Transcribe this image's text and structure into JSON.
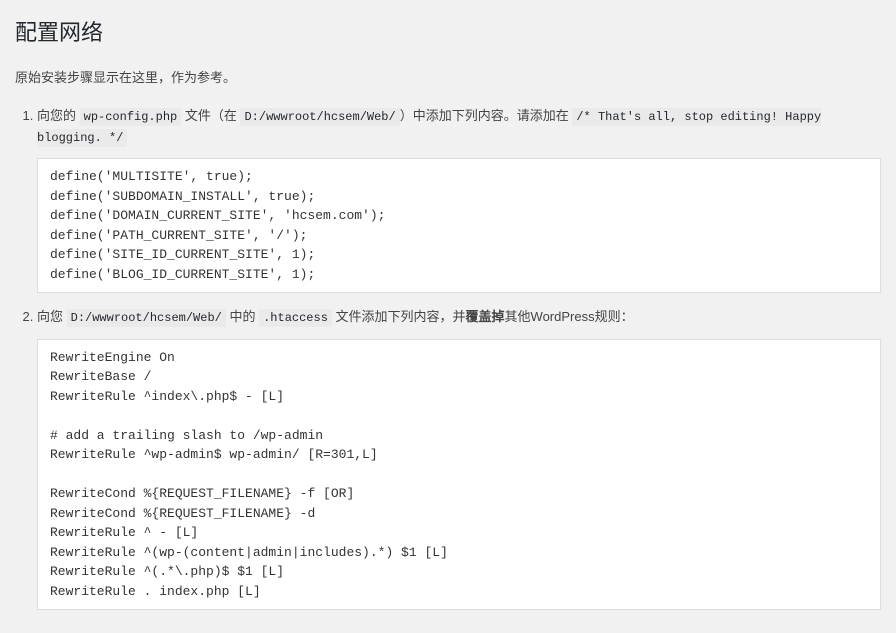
{
  "page": {
    "title": "配置网络",
    "subtitle": "原始安装步骤显示在这里，作为参考。"
  },
  "step1": {
    "txt1": "向您的 ",
    "code1": "wp-config.php",
    "txt2": " 文件（在 ",
    "code2": "D:/wwwroot/hcsem/Web/",
    "txt3": "）中添加下列内容。请添加在 ",
    "code3": "/* That's all, stop editing! Happy blogging. */",
    "codeblock": "define('MULTISITE', true);\ndefine('SUBDOMAIN_INSTALL', true);\ndefine('DOMAIN_CURRENT_SITE', 'hcsem.com');\ndefine('PATH_CURRENT_SITE', '/');\ndefine('SITE_ID_CURRENT_SITE', 1);\ndefine('BLOG_ID_CURRENT_SITE', 1);"
  },
  "step2": {
    "txt1": "向您 ",
    "code1": "D:/wwwroot/hcsem/Web/",
    "txt2": " 中的 ",
    "code2": ".htaccess",
    "txt3": " 文件添加下列内容，并",
    "bold": "覆盖掉",
    "txt4": "其他WordPress规则：",
    "codeblock": "RewriteEngine On\nRewriteBase /\nRewriteRule ^index\\.php$ - [L]\n\n# add a trailing slash to /wp-admin\nRewriteRule ^wp-admin$ wp-admin/ [R=301,L]\n\nRewriteCond %{REQUEST_FILENAME} -f [OR]\nRewriteCond %{REQUEST_FILENAME} -d\nRewriteRule ^ - [L]\nRewriteRule ^(wp-(content|admin|includes).*) $1 [L]\nRewriteRule ^(.*\\.php)$ $1 [L]\nRewriteRule . index.php [L]"
  }
}
